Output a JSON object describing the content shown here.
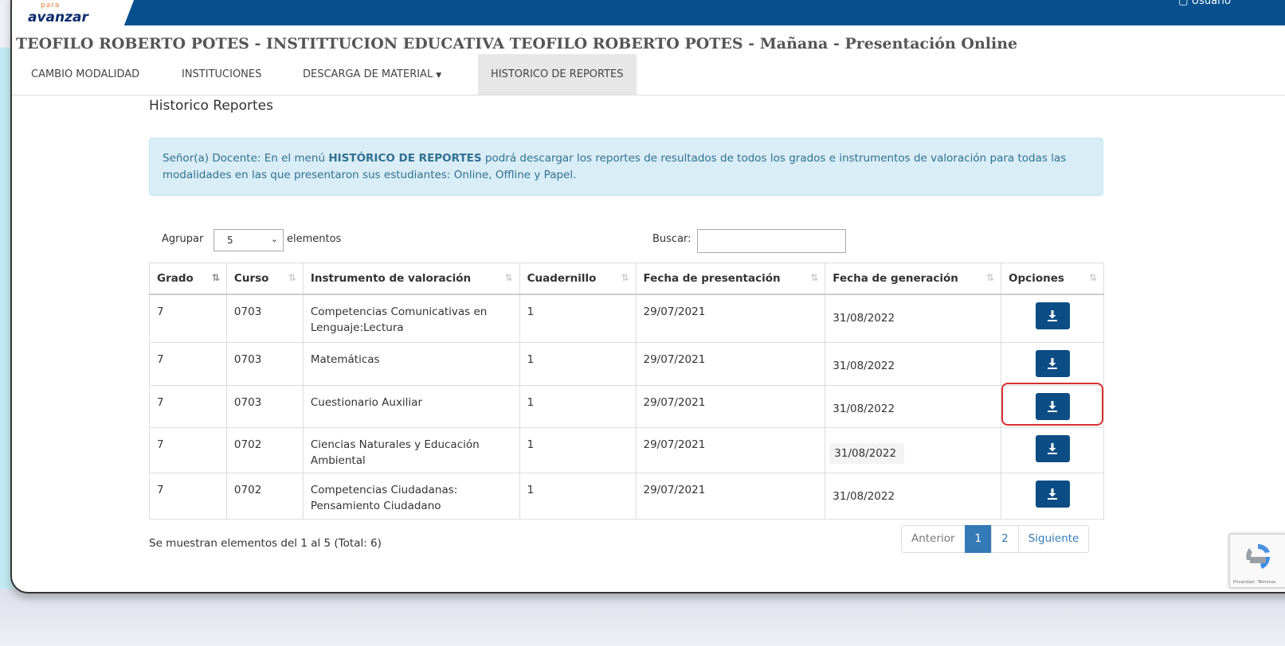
{
  "header": {
    "logo_small": "para",
    "logo_main": "avanzar",
    "user_label": "Usuario"
  },
  "page_title": "TEOFILO ROBERTO POTES - INSTITTUCION EDUCATIVA TEOFILO ROBERTO POTES - Mañana - Presentación Online",
  "nav": {
    "items": [
      {
        "label": "CAMBIO MODALIDAD"
      },
      {
        "label": "INSTITUCIONES"
      },
      {
        "label": "DESCARGA DE MATERIAL"
      },
      {
        "label": "HISTORICO DE REPORTES"
      }
    ]
  },
  "section_title": "Historico Reportes",
  "info": {
    "prefix": "Señor(a) Docente: En el menú ",
    "bold": "HISTÓRICO DE REPORTES",
    "suffix": " podrá descargar los reportes de resultados de todos los grados e instrumentos de valoración para todas las modalidades en las que presentaron sus estudiantes: Online, Offline y Papel."
  },
  "controls": {
    "group_label": "Agrupar",
    "group_value": "5",
    "elements_label": "elementos",
    "search_label": "Buscar:"
  },
  "table": {
    "headers": [
      "Grado",
      "Curso",
      "Instrumento de valoración",
      "Cuadernillo",
      "Fecha de presentación",
      "Fecha de generación",
      "Opciones"
    ],
    "rows": [
      {
        "grado": "7",
        "curso": "0703",
        "instrumento": "Competencias Comunicativas en Lenguaje:Lectura",
        "cuadernillo": "1",
        "fecha_presentacion": "29/07/2021",
        "fecha_generacion": "31/08/2022"
      },
      {
        "grado": "7",
        "curso": "0703",
        "instrumento": "Matemáticas",
        "cuadernillo": "1",
        "fecha_presentacion": "29/07/2021",
        "fecha_generacion": "31/08/2022"
      },
      {
        "grado": "7",
        "curso": "0703",
        "instrumento": "Cuestionario Auxiliar",
        "cuadernillo": "1",
        "fecha_presentacion": "29/07/2021",
        "fecha_generacion": "31/08/2022"
      },
      {
        "grado": "7",
        "curso": "0702",
        "instrumento": "Ciencias Naturales y Educación Ambiental",
        "cuadernillo": "1",
        "fecha_presentacion": "29/07/2021",
        "fecha_generacion": "31/08/2022"
      },
      {
        "grado": "7",
        "curso": "0702",
        "instrumento": "Competencias Ciudadanas: Pensamiento Ciudadano",
        "cuadernillo": "1",
        "fecha_presentacion": "29/07/2021",
        "fecha_generacion": "31/08/2022"
      }
    ]
  },
  "footer": {
    "info": "Se muestran elementos del 1 al 5 (Total: 6)",
    "prev": "Anterior",
    "pages": [
      "1",
      "2"
    ],
    "next": "Siguiente"
  },
  "recaptcha": {
    "text": "Privacidad - Términos"
  },
  "colors": {
    "brand": "#06508f",
    "button": "#0c4d85",
    "highlight": "#d93030",
    "info_bg": "#d9edf7"
  }
}
